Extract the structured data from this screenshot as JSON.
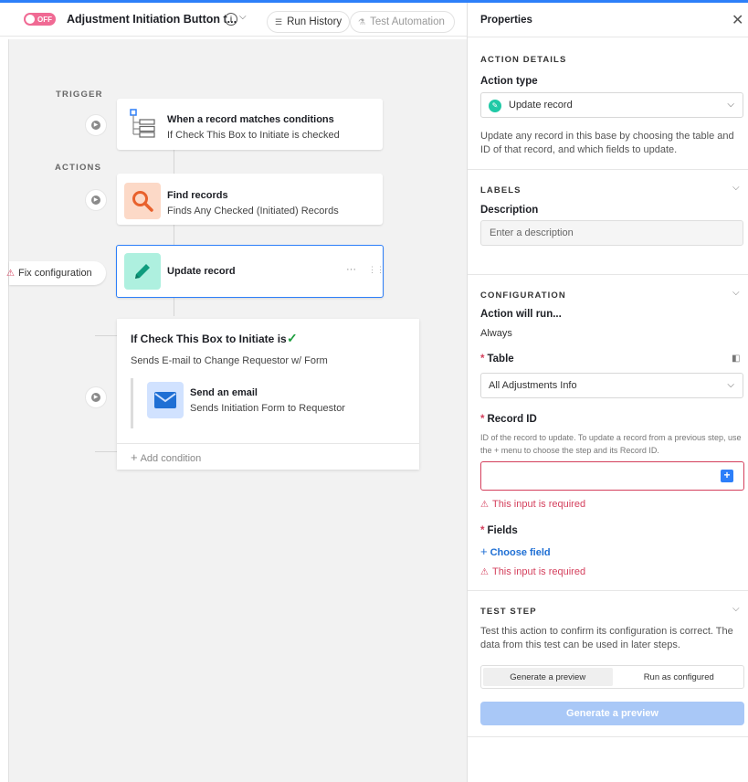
{
  "header": {
    "toggle_label": "OFF",
    "title": "Adjustment Initiation Button t...",
    "run_history": "Run History",
    "test_automation": "Test Automation"
  },
  "canvas": {
    "trigger_label": "TRIGGER",
    "actions_label": "ACTIONS",
    "trigger": {
      "title": "When a record matches conditions",
      "subtitle": "If Check This Box to Initiate is checked"
    },
    "find": {
      "title": "Find records",
      "subtitle": "Finds Any Checked (Initiated) Records"
    },
    "update": {
      "title": "Update record",
      "more": "···",
      "drag": "⋮⋮"
    },
    "fix_config": "Fix configuration",
    "condition": {
      "title": "If Check This Box to Initiate is",
      "subtitle": "Sends E-mail to Change Requestor w/ Form",
      "email_title": "Send an email",
      "email_subtitle": "Sends Initiation Form to Requestor",
      "add_condition": "Add condition"
    }
  },
  "panel": {
    "title": "Properties",
    "action_details": {
      "section": "ACTION DETAILS",
      "action_type_label": "Action type",
      "action_type_value": "Update record",
      "description": "Update any record in this base by choosing the table and ID of that record, and which fields to update."
    },
    "labels": {
      "section": "LABELS",
      "description_label": "Description",
      "description_placeholder": "Enter a description"
    },
    "configuration": {
      "section": "CONFIGURATION",
      "will_run_label": "Action will run...",
      "will_run_value": "Always",
      "table_label": "Table",
      "table_value": "All Adjustments Info",
      "record_id_label": "Record ID",
      "record_id_help": "ID of the record to update. To update a record from a previous step, use the + menu to choose the step and its Record ID.",
      "record_id_error": "This input is required",
      "fields_label": "Fields",
      "choose_field": "Choose field",
      "fields_error": "This input is required"
    },
    "test_step": {
      "section": "TEST STEP",
      "description": "Test this action to confirm its configuration is correct. The data from this test can be used in later steps.",
      "tab_preview": "Generate a preview",
      "tab_run": "Run as configured",
      "generate_button": "Generate a preview"
    }
  },
  "colors": {
    "accent": "#2d7ff9",
    "error": "#d43f5c",
    "toggle_off": "#f06a94",
    "teal": "#20c9a6"
  }
}
